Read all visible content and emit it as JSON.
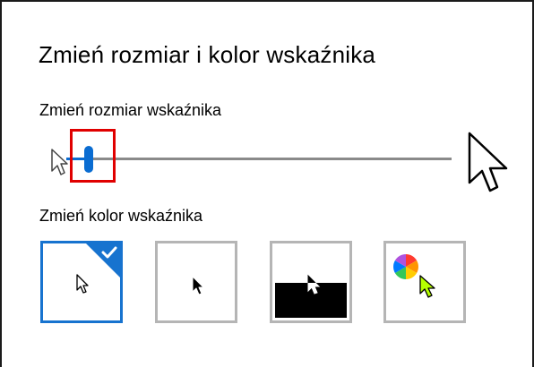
{
  "dialog": {
    "title": "Zmień rozmiar i kolor wskaźnika"
  },
  "pointer_size": {
    "label": "Zmień rozmiar wskaźnika",
    "slider_value": 1,
    "slider_min": 1,
    "slider_max": 15
  },
  "pointer_color": {
    "label": "Zmień kolor wskaźnika",
    "options": [
      {
        "icon": "white-pointer-icon",
        "selected": true
      },
      {
        "icon": "black-pointer-icon",
        "selected": false
      },
      {
        "icon": "inverted-pointer-icon",
        "selected": false
      },
      {
        "icon": "custom-color-pointer-icon",
        "selected": false
      }
    ]
  },
  "colors": {
    "accent": "#1773cf",
    "slider_accent": "#0a6cd1",
    "highlight": "#e00000",
    "custom_pointer": "#b6ff00",
    "swatch_border": "#b5b5b5"
  }
}
